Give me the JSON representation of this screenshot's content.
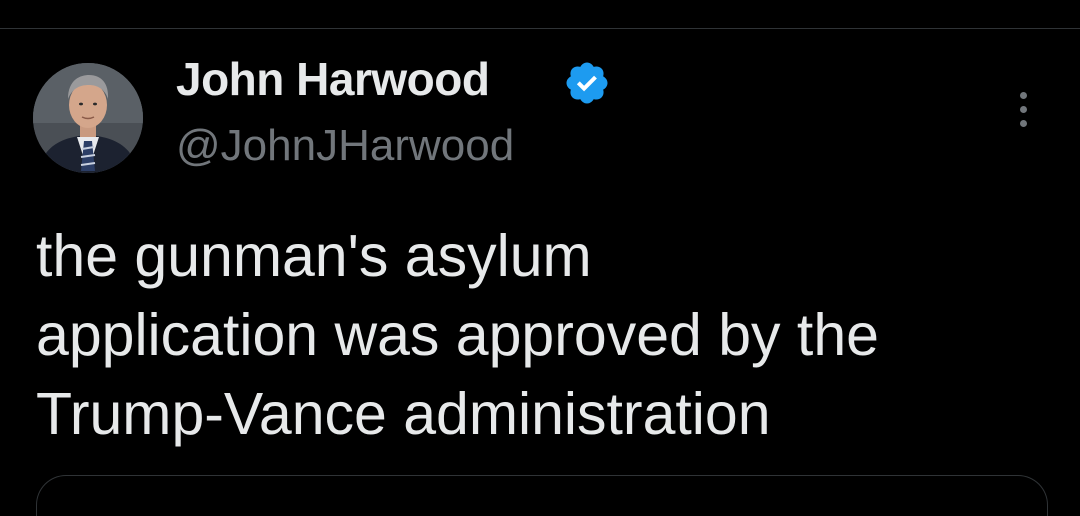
{
  "tweet": {
    "author": {
      "name": "John Harwood",
      "handle": "@JohnJHarwood",
      "verified": true
    },
    "text_lines": [
      "the gunman's asylum",
      "application was approved by the",
      "Trump-Vance administration"
    ]
  },
  "colors": {
    "background": "#000000",
    "text_primary": "#e7e9ea",
    "text_secondary": "#71767b",
    "verified_badge": "#1d9bf0",
    "divider": "#2f3336"
  },
  "icons": {
    "verified": "verified-badge-icon",
    "more": "more-options-icon"
  }
}
